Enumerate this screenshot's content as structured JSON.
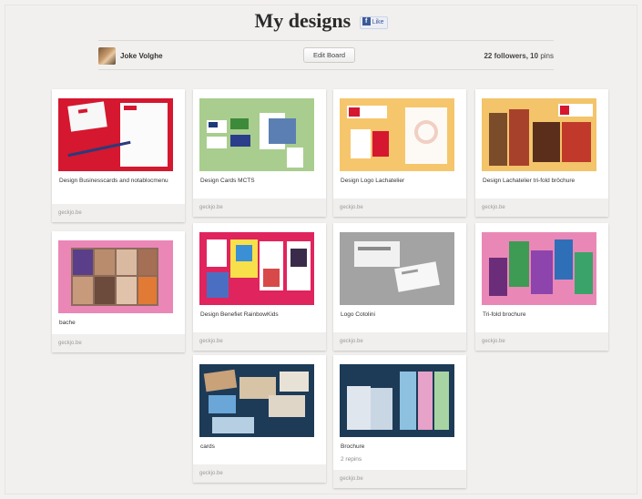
{
  "board": {
    "title": "My designs",
    "fb_like_label": "Like",
    "owner_name": "Joke Volghe",
    "edit_button": "Edit Board",
    "followers_count": "22",
    "followers_label": "followers,",
    "pins_count": "10",
    "pins_label": "pins"
  },
  "colors": {
    "background": "#f2f0ee",
    "card": "#ffffff",
    "source_strip": "#f0efee",
    "fb_blue": "#3b5998"
  },
  "pins": [
    {
      "caption": "Design Businesscards and notablocmenu",
      "source": "geckjo.be",
      "image": "red-stationery"
    },
    {
      "caption": "Design Cards MCTS",
      "source": "geckjo.be",
      "image": "green-cards"
    },
    {
      "caption": "Design Logo Lachatelier",
      "source": "geckjo.be",
      "image": "yellow-logo"
    },
    {
      "caption": "Design Lachatelier tri-fold bröchure",
      "source": "geckjo.be",
      "image": "yellow-brochure"
    },
    {
      "caption": "bache",
      "source": "geckjo.be",
      "image": "pink-banner"
    },
    {
      "caption": "Design Benefiet RainbowKids",
      "source": "geckjo.be",
      "image": "pink-flyers"
    },
    {
      "caption": "Logo Cotolini",
      "source": "geckjo.be",
      "image": "grey-logo"
    },
    {
      "caption": "Tri-fold brochure",
      "source": "geckjo.be",
      "image": "pink-brochure"
    },
    {
      "caption": "cards",
      "source": "geckjo.be",
      "image": "navy-cards"
    },
    {
      "caption": "Brochure",
      "repins": "2 repins",
      "source": "geckjo.be",
      "image": "navy-brochure"
    }
  ]
}
